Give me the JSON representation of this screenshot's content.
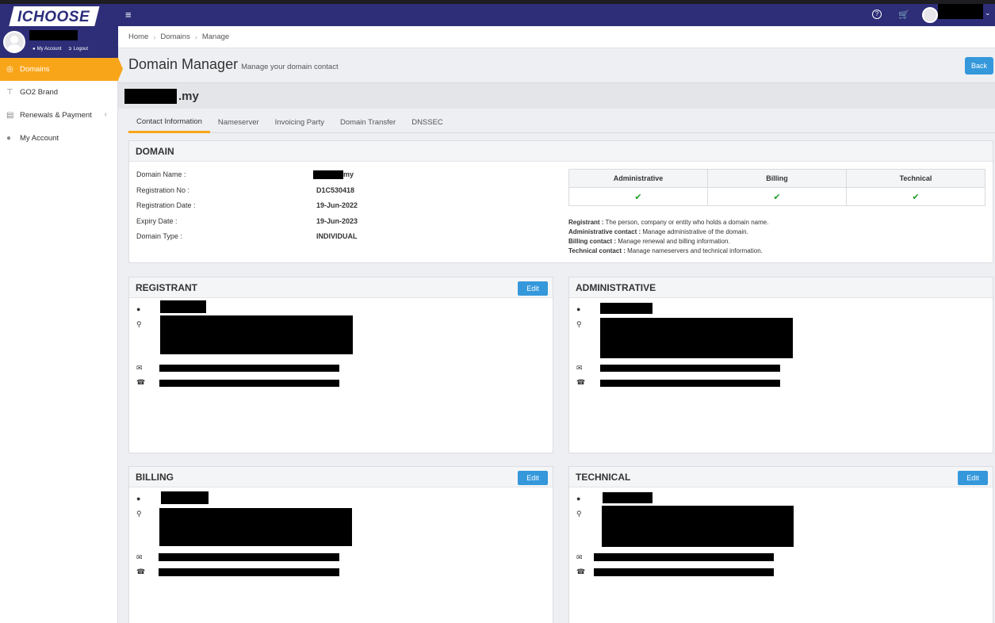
{
  "app": {
    "logo": "ICHOOSE"
  },
  "user": {
    "my_account": "My Account",
    "logout": "Logout"
  },
  "sidebar": {
    "items": [
      {
        "label": "Domains",
        "icon": "globe-icon"
      },
      {
        "label": "GO2 Brand",
        "icon": "signpost-icon"
      },
      {
        "label": "Renewals & Payment",
        "icon": "credit-card-icon"
      },
      {
        "label": "My Account",
        "icon": "user-icon"
      }
    ]
  },
  "topbar": {
    "icons": [
      "menu-icon",
      "help-icon",
      "cart-icon",
      "avatar",
      "chevron-down-icon"
    ]
  },
  "breadcrumb": [
    "Home",
    "Domains",
    "Manage"
  ],
  "header": {
    "title": "Domain Manager",
    "subtitle": "Manage your domain contact",
    "back": "Back"
  },
  "domain": {
    "name_suffix": ".my"
  },
  "tabs": [
    "Contact Information",
    "Nameserver",
    "Invoicing Party",
    "Domain Transfer",
    "DNSSEC"
  ],
  "domain_panel": {
    "title": "DOMAIN",
    "rows": [
      {
        "label": "Domain Name :",
        "value": "my"
      },
      {
        "label": "Registration No :",
        "value": "D1C530418"
      },
      {
        "label": "Registration Date :",
        "value": "19-Jun-2022"
      },
      {
        "label": "Expiry Date :",
        "value": "19-Jun-2023"
      },
      {
        "label": "Domain Type :",
        "value": "INDIVIDUAL"
      }
    ],
    "contact_table": {
      "headers": [
        "Administrative",
        "Billing",
        "Technical"
      ],
      "values": [
        "✔",
        "✔",
        "✔"
      ]
    },
    "legend": [
      {
        "term": "Registrant :",
        "text": "The person, company or entity who holds a domain name."
      },
      {
        "term": "Administrative contact :",
        "text": "Manage administrative of the domain."
      },
      {
        "term": "Billing contact :",
        "text": "Manage renewal and billing information."
      },
      {
        "term": "Technical contact :",
        "text": "Manage nameservers and technical information."
      }
    ]
  },
  "contacts": {
    "registrant": {
      "title": "REGISTRANT",
      "edit": "Edit"
    },
    "administrative": {
      "title": "ADMINISTRATIVE"
    },
    "billing": {
      "title": "BILLING",
      "edit": "Edit"
    },
    "technical": {
      "title": "TECHNICAL",
      "edit": "Edit"
    }
  },
  "colors": {
    "accent": "#f9a51a",
    "brand": "#2d2d78",
    "button": "#3498db",
    "check": "#1f9d2b"
  }
}
